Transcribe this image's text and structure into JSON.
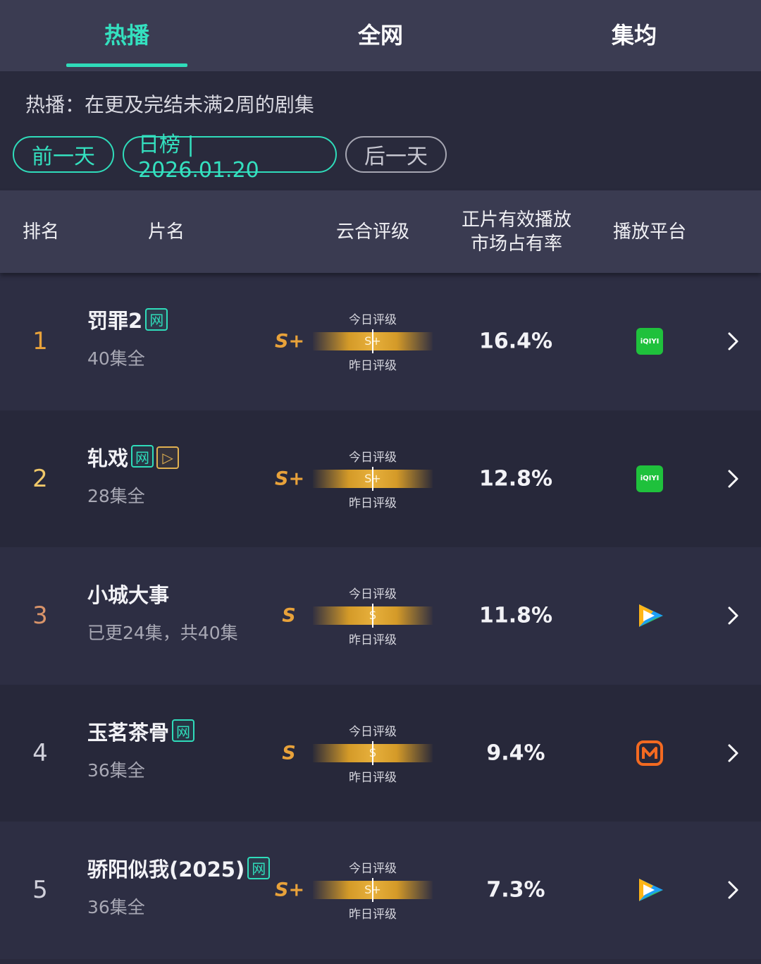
{
  "tabs": [
    {
      "label": "热播",
      "active": true
    },
    {
      "label": "全网",
      "active": false
    },
    {
      "label": "集均",
      "active": false
    }
  ],
  "filter": {
    "description": "热播：在更及完结未满2周的剧集",
    "prev_label": "前一天",
    "date_label": "日榜 | 2026.01.20",
    "next_label": "后一天"
  },
  "table_header": {
    "rank": "排名",
    "title": "片名",
    "grade": "云合评级",
    "share_line1": "正片有效播放",
    "share_line2": "市场占有率",
    "platform": "播放平台"
  },
  "rows": [
    {
      "rank": "1",
      "title": "罚罪2",
      "badges": [
        "网"
      ],
      "episodes": "40集全",
      "grade": "S+",
      "today_label": "今日评级",
      "bar_grade": "S+",
      "yesterday_label": "昨日评级",
      "share": "16.4%",
      "platform": "iqiyi",
      "platform_text": "iQIYI"
    },
    {
      "rank": "2",
      "title": "轧戏",
      "badges": [
        "网",
        "▷"
      ],
      "episodes": "28集全",
      "grade": "S+",
      "today_label": "今日评级",
      "bar_grade": "S+",
      "yesterday_label": "昨日评级",
      "share": "12.8%",
      "platform": "iqiyi",
      "platform_text": "iQIYI"
    },
    {
      "rank": "3",
      "title": "小城大事",
      "badges": [],
      "episodes": "已更24集，共40集",
      "grade": "S",
      "today_label": "今日评级",
      "bar_grade": "S",
      "yesterday_label": "昨日评级",
      "share": "11.8%",
      "platform": "tencent-video",
      "platform_text": ""
    },
    {
      "rank": "4",
      "title": "玉茗茶骨",
      "badges": [
        "网"
      ],
      "episodes": "36集全",
      "grade": "S",
      "today_label": "今日评级",
      "bar_grade": "S",
      "yesterday_label": "昨日评级",
      "share": "9.4%",
      "platform": "mango-tv",
      "platform_text": ""
    },
    {
      "rank": "5",
      "title": "骄阳似我(2025)",
      "badges": [
        "网"
      ],
      "episodes": "36集全",
      "grade": "S+",
      "today_label": "今日评级",
      "bar_grade": "S+",
      "yesterday_label": "昨日评级",
      "share": "7.3%",
      "platform": "tencent-video",
      "platform_text": ""
    }
  ],
  "colors": {
    "accent": "#2fdcba",
    "grade": "#e8a23a",
    "rank1": "#e8a23a",
    "rank2": "#f0c869",
    "rank3": "#d9946a",
    "rank_default": "#d0d0da"
  }
}
